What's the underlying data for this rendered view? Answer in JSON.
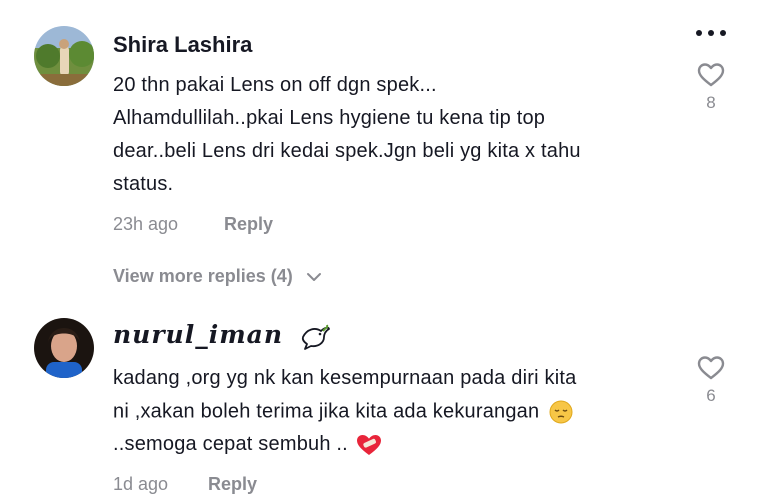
{
  "comments": [
    {
      "username": "Shira Lashira",
      "lines": [
        "20 thn pakai Lens on off dgn spek...",
        "Alhamdullilah..pkai Lens hygiene tu kena tip top",
        "dear..beli Lens dri kedai spek.Jgn beli yg kita x tahu",
        "status."
      ],
      "time": "23h ago",
      "reply_label": "Reply",
      "likes": "8",
      "view_more": "View more replies (4)"
    },
    {
      "username": "𝓷𝓾𝓻𝓾𝓵_𝓲𝓶𝓪𝓷",
      "username_display": "nurul_iman",
      "lines": [
        "kadang ,org yg nk kan kesempurnaan pada diri kita",
        "ni ,xakan boleh terima jika kita ada kekurangan",
        "..semoga cepat sembuh .."
      ],
      "time": "1d ago",
      "reply_label": "Reply",
      "likes": "6"
    }
  ],
  "icons": {
    "more": "more-horizontal-icon",
    "like": "heart-outline-icon",
    "chevron": "chevron-down-icon",
    "dove": "dove-emoji",
    "pensive": "pensive-face-emoji",
    "heart": "heart-with-bandage-emoji"
  },
  "colors": {
    "text": "#161823",
    "muted": "#8a8b91"
  }
}
